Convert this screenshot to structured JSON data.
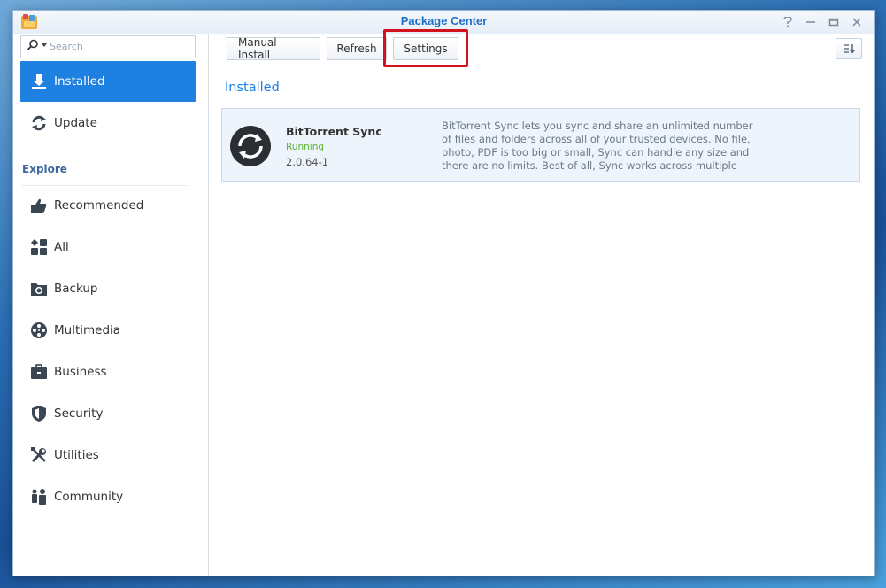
{
  "window": {
    "title": "Package Center",
    "controls": [
      "help-icon",
      "minimize-icon",
      "maximize-icon",
      "close-icon"
    ]
  },
  "search": {
    "placeholder": "Search",
    "value": ""
  },
  "sidebar": {
    "items": [
      {
        "label": "Installed",
        "icon": "download-icon",
        "active": true
      },
      {
        "label": "Update",
        "icon": "refresh-arrows-icon",
        "active": false
      }
    ],
    "explore_heading": "Explore",
    "explore_items": [
      {
        "label": "Recommended",
        "icon": "thumbs-up-icon"
      },
      {
        "label": "All",
        "icon": "grid-icon"
      },
      {
        "label": "Backup",
        "icon": "backup-icon"
      },
      {
        "label": "Multimedia",
        "icon": "film-reel-icon"
      },
      {
        "label": "Business",
        "icon": "briefcase-icon"
      },
      {
        "label": "Security",
        "icon": "shield-icon"
      },
      {
        "label": "Utilities",
        "icon": "tools-icon"
      },
      {
        "label": "Community",
        "icon": "people-icon"
      }
    ]
  },
  "toolbar": {
    "manual_install": "Manual Install",
    "refresh": "Refresh",
    "settings": "Settings"
  },
  "main": {
    "section_title": "Installed",
    "packages": [
      {
        "name": "BitTorrent Sync",
        "status": "Running",
        "version": "2.0.64-1",
        "description": "BitTorrent Sync lets you sync and share an unlimited number of files and folders across all of your trusted devices. No file, photo, PDF is too big or small, Sync can handle any size and there are no limits. Best of all, Sync works across multiple"
      }
    ]
  },
  "colors": {
    "accent": "#1e80e0",
    "title": "#1e6fc7",
    "running": "#5fb134",
    "highlight": "#d2121c"
  }
}
